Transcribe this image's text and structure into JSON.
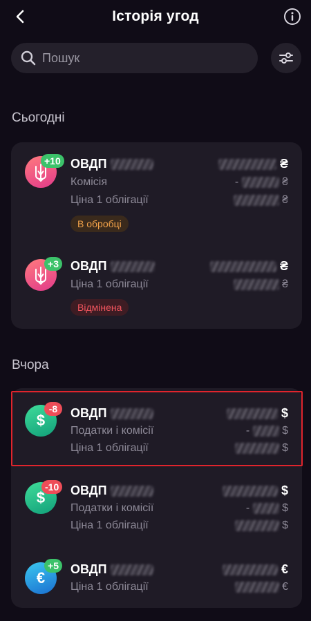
{
  "header": {
    "title": "Історія угод"
  },
  "search": {
    "placeholder": "Пошук"
  },
  "sections": [
    {
      "title": "Сьогодні"
    },
    {
      "title": "Вчора"
    }
  ],
  "transactions": [
    {
      "name": "ОВДП",
      "badge": "+10",
      "lines": [
        "Комісія",
        "Ціна 1 облігації"
      ],
      "amount_prefix": "",
      "currency": "₴",
      "sub_prefixes": [
        "-",
        ""
      ],
      "sub_currency": "₴",
      "status": "В обробці",
      "icon": "ukraine-trident-icon"
    },
    {
      "name": "ОВДП",
      "badge": "+3",
      "lines": [
        "Ціна 1 облігації"
      ],
      "amount_prefix": "",
      "currency": "₴",
      "sub_prefixes": [
        ""
      ],
      "sub_currency": "₴",
      "status": "Відмінена",
      "icon": "ukraine-trident-icon"
    },
    {
      "name": "ОВДП",
      "badge": "-8",
      "lines": [
        "Податки і комісії",
        "Ціна 1 облігації"
      ],
      "amount_prefix": "",
      "currency": "$",
      "sub_prefixes": [
        "-",
        ""
      ],
      "sub_currency": "$",
      "status": "",
      "icon": "dollar-icon"
    },
    {
      "name": "ОВДП",
      "badge": "-10",
      "lines": [
        "Податки і комісії",
        "Ціна 1 облігації"
      ],
      "amount_prefix": "",
      "currency": "$",
      "sub_prefixes": [
        "-",
        ""
      ],
      "sub_currency": "$",
      "status": "",
      "icon": "dollar-icon"
    },
    {
      "name": "ОВДП",
      "badge": "+5",
      "lines": [
        "Ціна 1 облігації"
      ],
      "amount_prefix": "",
      "currency": "€",
      "sub_prefixes": [
        ""
      ],
      "sub_currency": "€",
      "status": "",
      "icon": "euro-icon"
    }
  ],
  "glyphs": {
    "dollar": "$",
    "euro": "€"
  },
  "colors": {
    "background": "#100c17",
    "card": "#1f1b26",
    "badge_positive": "#3cc26a",
    "badge_negative": "#ee4d58",
    "status_processing": "#f2a24a",
    "status_cancelled": "#f2555e",
    "highlight": "#e0242c"
  }
}
